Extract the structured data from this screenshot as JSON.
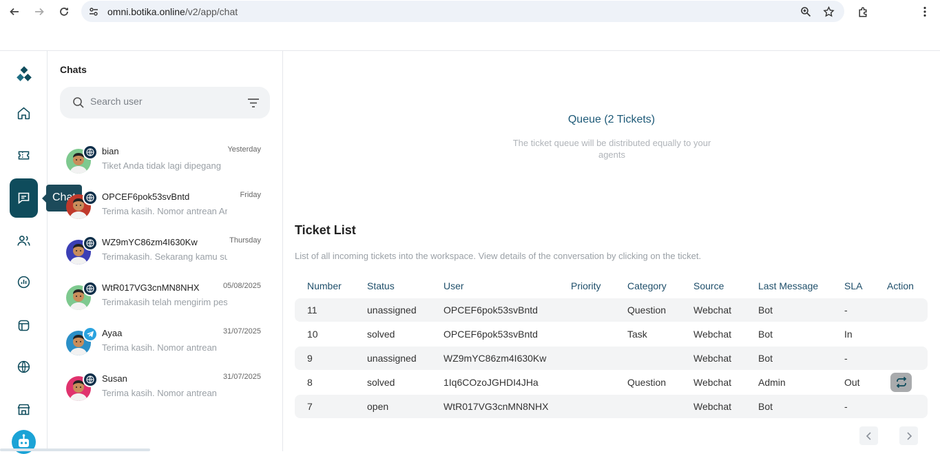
{
  "browser": {
    "url_host": "omni.botika.online",
    "url_path": "/v2/app/chat"
  },
  "rail": {
    "tooltip": "Chat"
  },
  "chat_panel": {
    "title": "Chats",
    "search_placeholder": "Search user",
    "items": [
      {
        "name": "bian",
        "preview": "Tiket Anda tidak lagi dipegang",
        "time": "Yesterday",
        "channel": "globe-icon",
        "avatar_color": "#7ec98f"
      },
      {
        "name": "OPCEF6pok53svBntd",
        "preview": "Terima kasih. Nomor antrean Anda",
        "time": "Friday",
        "channel": "globe-icon",
        "avatar_color": "#c0392b"
      },
      {
        "name": "WZ9mYC86zm4I630Kw",
        "preview": "Terimakasih. Sekarang kamu sudah",
        "time": "Thursday",
        "channel": "globe-icon",
        "avatar_color": "#3b3fb5"
      },
      {
        "name": "WtR017VG3cnMN8NHX",
        "preview": "Terimakasih telah mengirim pesan",
        "time": "05/08/2025",
        "channel": "globe-icon",
        "avatar_color": "#7ec98f"
      },
      {
        "name": "Ayaa",
        "preview": "Terima kasih. Nomor antrean",
        "time": "31/07/2025",
        "channel": "telegram-icon",
        "avatar_color": "#2a8fc7"
      },
      {
        "name": "Susan",
        "preview": "Terima kasih. Nomor antrean",
        "time": "31/07/2025",
        "channel": "globe-icon",
        "avatar_color": "#e0336e"
      }
    ]
  },
  "queue": {
    "title": "Queue (2 Tickets)",
    "description": "The ticket queue will be distributed equally to your agents"
  },
  "tickets": {
    "title": "Ticket List",
    "description": "List of all incoming tickets into the workspace. View details of the conversation by clicking on the ticket.",
    "columns": [
      "Number",
      "Status",
      "User",
      "Priority",
      "Category",
      "Source",
      "Last Message",
      "SLA",
      "Action"
    ],
    "rows": [
      {
        "number": "11",
        "status": "unassigned",
        "user": "OPCEF6pok53svBntd",
        "priority": "",
        "category": "Question",
        "source": "Webchat",
        "last_message": "Bot",
        "sla": "-",
        "action": false
      },
      {
        "number": "10",
        "status": "solved",
        "user": "OPCEF6pok53svBntd",
        "priority": "",
        "category": "Task",
        "source": "Webchat",
        "last_message": "Bot",
        "sla": "In",
        "action": false
      },
      {
        "number": "9",
        "status": "unassigned",
        "user": "WZ9mYC86zm4I630Kw",
        "priority": "",
        "category": "",
        "source": "Webchat",
        "last_message": "Bot",
        "sla": "-",
        "action": false
      },
      {
        "number": "8",
        "status": "solved",
        "user": "1Iq6COzoJGHDI4JHa",
        "priority": "",
        "category": "Question",
        "source": "Webchat",
        "last_message": "Admin",
        "sla": "Out",
        "action": true
      },
      {
        "number": "7",
        "status": "open",
        "user": "WtR017VG3cnMN8NHX",
        "priority": "",
        "category": "",
        "source": "Webchat",
        "last_message": "Bot",
        "sla": "-",
        "action": false
      }
    ]
  },
  "colors": {
    "accent": "#0f4c5c",
    "header_text": "#1e4e6a"
  }
}
